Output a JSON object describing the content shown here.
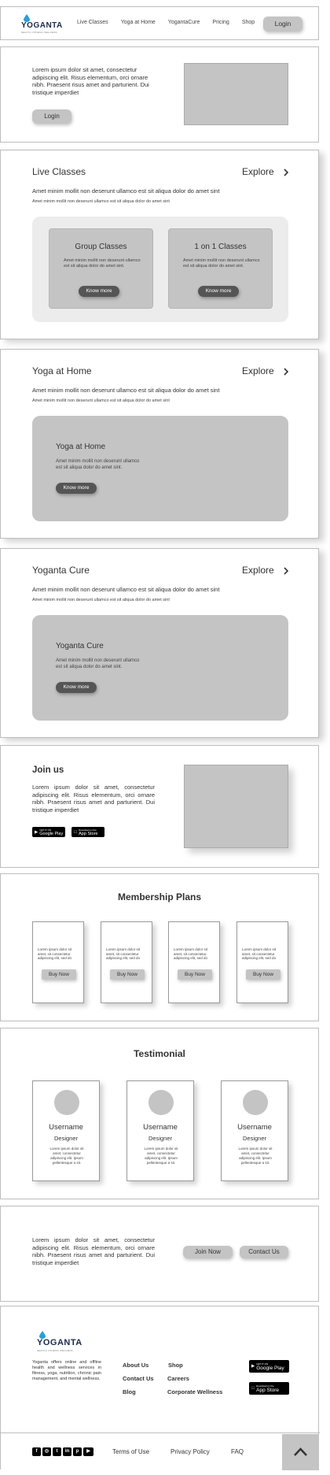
{
  "brand": {
    "name": "YOGANTA",
    "tagline": "HEALTH | FITNESS | WELLNESS"
  },
  "nav": {
    "links": [
      "Live Classes",
      "Yoga at Home",
      "YogantaCure",
      "Pricing",
      "Shop"
    ],
    "login": "Login"
  },
  "hero": {
    "text": "Lorem ipsum dolor sit amet, consectetur adipiscing elit. Risus elementum, orci ornare nibh. Praesent risus amet and parturient. Dui tristique imperdiet",
    "login": "Login"
  },
  "live_classes": {
    "title": "Live Classes",
    "explore": "Explore",
    "sub1": "Amet minim mollit non deserunt ullamco est sit aliqua dolor do amet sint",
    "sub2": "Amet minim mollit non deserunt ullamco est sit aliqua dolor do amet sint",
    "cards": [
      {
        "title": "Group Classes",
        "desc": "Amet minim mollit non deserunt ullamco est sit aliqua dolor do amet sint.",
        "button": "Know more"
      },
      {
        "title": "1 on 1 Classes",
        "desc": "Amet minim mollit non deserunt ullamco est sit aliqua dolor do amet sint.",
        "button": "Know more"
      }
    ]
  },
  "yoga_home": {
    "title": "Yoga at Home",
    "explore": "Explore",
    "sub1": "Amet minim mollit non deserunt ullamco est sit aliqua dolor do amet sint",
    "sub2": "Amet minim mollit non deserunt ullamco est sit aliqua dolor do amet sint",
    "feature_title": "Yoga at Home",
    "feature_desc": "Amet minim mollit non deserunt ullamco est sit aliqua dolor do amet sint.",
    "button": "Know more"
  },
  "yoganta_cure": {
    "title": "Yoganta Cure",
    "explore": "Explore",
    "sub1": "Amet minim mollit non deserunt ullamco est sit aliqua dolor do amet sint",
    "sub2": "Amet minim mollit non deserunt ullamco est sit aliqua dolor do amet sint",
    "feature_title": "Yoganta Cure",
    "feature_desc": "Amet minim mollit non deserunt ullamco est sit aliqua dolor do amet sint.",
    "button": "Know more"
  },
  "join": {
    "title": "Join us",
    "text": "Lorem ipsum dolor sit amet, consectetur adipiscing elit. Risus elementum, orci ornare nibh. Praesent risus amet and parturient. Dui tristique imperdiet",
    "google_play": "Google Play",
    "app_store": "App Store",
    "google_small": "GET IT ON",
    "apple_small": "Download on the"
  },
  "membership": {
    "title": "Membership Plans",
    "plans": [
      {
        "desc": "Lorem ipsum dolor sit amet, sit consectetur adipiscing elit, sed do",
        "button": "Buy Now"
      },
      {
        "desc": "Lorem ipsum dolor sit amet, sit consectetur adipiscing elit, sed do",
        "button": "Buy Now"
      },
      {
        "desc": "Lorem ipsum dolor sit amet, sit consectetur adipiscing elit, sed do",
        "button": "Buy Now"
      },
      {
        "desc": "Lorem ipsum dolor sit amet, sit consectetur adipiscing elit, sed do",
        "button": "Buy Now"
      }
    ]
  },
  "testimonial": {
    "title": "Testimonial",
    "cards": [
      {
        "name": "Username",
        "role": "Designer",
        "text": "Lorem ipsum dolor sit amet, consectetur adipiscing elit. Ipsum pellentesque a sit."
      },
      {
        "name": "Username",
        "role": "Designer",
        "text": "Lorem ipsum dolor sit amet, consectetur adipiscing elit. Ipsum pellentesque a sit."
      },
      {
        "name": "Username",
        "role": "Designer",
        "text": "Lorem ipsum dolor sit amet, consectetur adipiscing elit. Ipsum pellentesque a sit."
      }
    ]
  },
  "cta": {
    "text": "Lorem ipsum dolor sit amet, consectetur adipiscing elit. Risus elementum, orci ornare nibh. Praesent risus amet and parturient. Dui tristique imperdiet",
    "join": "Join Now",
    "contact": "Contact Us"
  },
  "footer": {
    "about": "Yoganta offers online and offline health and wellness services in fitness, yoga, nutrition, chronic pain management, and mental wellness.",
    "col1": [
      "About Us",
      "Contact Us",
      "Blog"
    ],
    "col2": [
      "Shop",
      "Careers",
      "Corporate Wellness"
    ],
    "google_play": "Google Play",
    "app_store": "App Store",
    "google_small": "GET IT ON",
    "apple_small": "Download on the",
    "social": [
      "facebook-icon",
      "instagram-icon",
      "twitter-icon",
      "linkedin-icon",
      "pinterest-icon",
      "youtube-icon"
    ],
    "bottom_links": [
      "Terms of Use",
      "Privacy Policy",
      "FAQ"
    ]
  },
  "colors": {
    "placeholder": "#c4c4c4",
    "panel_light": "#ececec",
    "button_dark": "#555555",
    "brand_blue": "#2a9fd6"
  }
}
